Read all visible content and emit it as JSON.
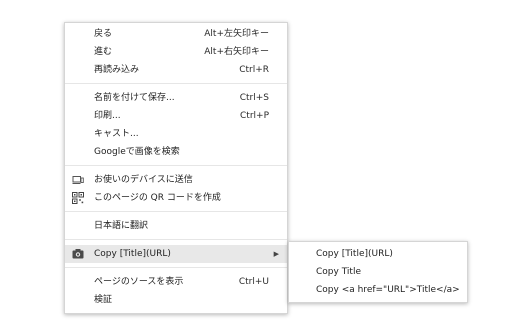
{
  "menu": {
    "back": {
      "label": "戻る",
      "shortcut": "Alt+左矢印キー"
    },
    "forward": {
      "label": "進む",
      "shortcut": "Alt+右矢印キー"
    },
    "reload": {
      "label": "再読み込み",
      "shortcut": "Ctrl+R"
    },
    "save_as": {
      "label": "名前を付けて保存...",
      "shortcut": "Ctrl+S"
    },
    "print": {
      "label": "印刷...",
      "shortcut": "Ctrl+P"
    },
    "cast": {
      "label": "キャスト..."
    },
    "search_image": {
      "label": "Googleで画像を検索"
    },
    "send_to_devices": {
      "label": "お使いのデバイスに送信",
      "icon": "device-icon"
    },
    "qr_code": {
      "label": "このページの QR コードを作成",
      "icon": "qr-code-icon"
    },
    "translate": {
      "label": "日本語に翻訳"
    },
    "copy_title_url": {
      "label": "Copy [Title](URL)",
      "icon": "extension-icon",
      "arrow": "▶"
    },
    "view_source": {
      "label": "ページのソースを表示",
      "shortcut": "Ctrl+U"
    },
    "inspect": {
      "label": "検証"
    }
  },
  "submenu": {
    "items": [
      {
        "label": "Copy [Title](URL)"
      },
      {
        "label": "Copy Title"
      },
      {
        "label": "Copy <a href=\"URL\">Title</a>"
      }
    ]
  },
  "colors": {
    "highlight": "#e8e8e8",
    "separator": "#e6e6e6",
    "border": "#d5d5d5"
  }
}
